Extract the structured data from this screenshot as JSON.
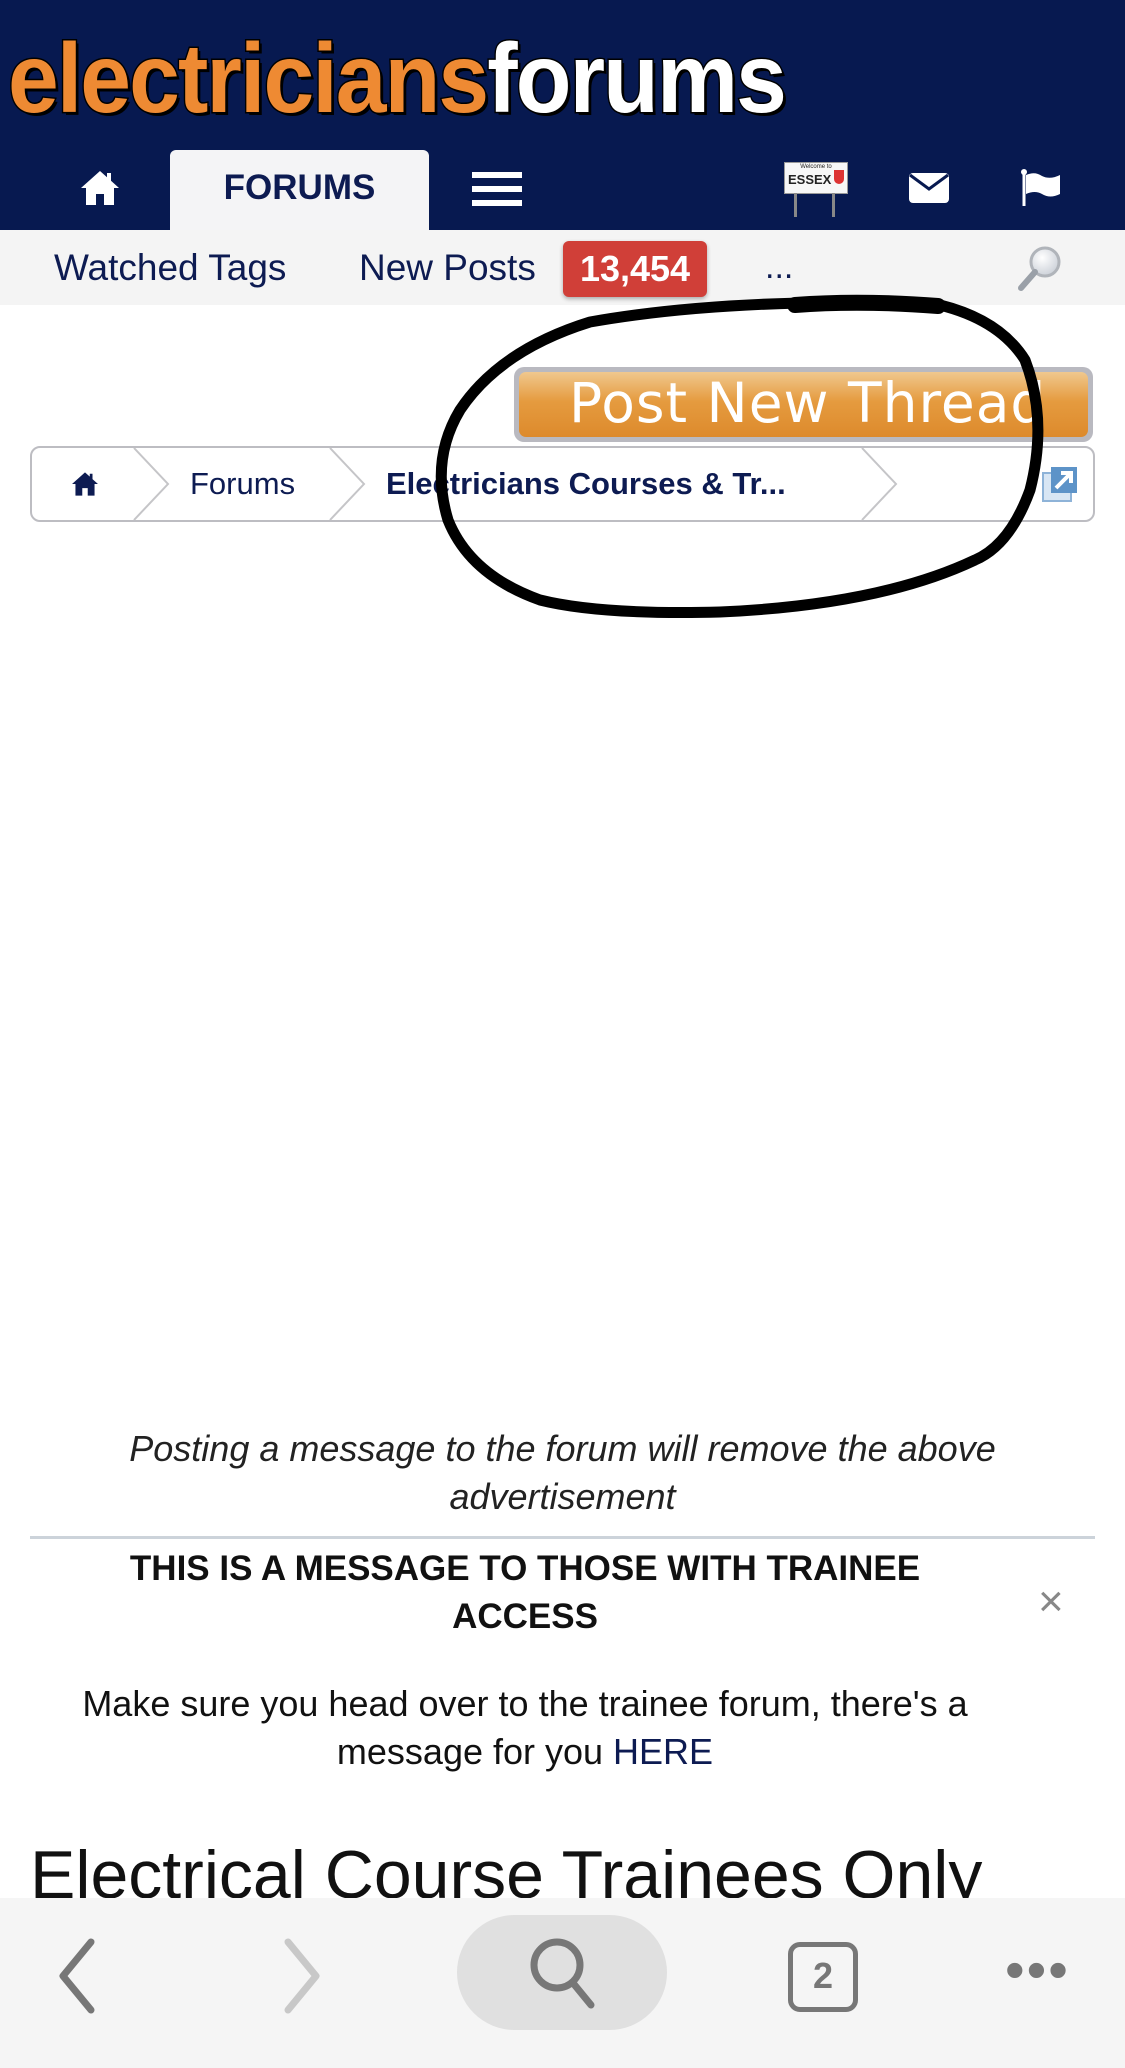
{
  "header": {
    "logo_part1": "electricians",
    "logo_part2": "forums",
    "colors": {
      "background": "#071950",
      "logo_orange": "#ee8a33",
      "logo_white": "#ffffff"
    },
    "nav": {
      "home_icon": "home-icon",
      "forums_tab": "FORUMS",
      "menu_icon": "hamburger-menu-icon",
      "essex_sign": {
        "small_text": "Welcome to",
        "text": "ESSEX"
      },
      "mail_icon": "envelope-icon",
      "flag_icon": "flag-icon"
    }
  },
  "subnav": {
    "watched_tags": "Watched Tags",
    "new_posts": "New Posts",
    "new_posts_count": "13,454",
    "more": "...",
    "search_icon": "magnifier-icon",
    "badge_color": "#d03f38"
  },
  "actions": {
    "post_new_thread": "Post New Thread"
  },
  "breadcrumb": {
    "home_icon": "home-icon",
    "items": [
      "Forums",
      "Electricians Courses & Tr..."
    ],
    "expand_icon": "external-link-icon"
  },
  "ad_notice": "Posting a message to the forum will remove the above advertisement",
  "message": {
    "title": "THIS IS A MESSAGE TO THOSE WITH TRAINEE ACCESS",
    "close": "×",
    "body_prefix": "Make sure you head over to the trainee forum, there's a message for you ",
    "link": "HERE"
  },
  "page_heading": "Electrical Course Trainees Only",
  "browser_toolbar": {
    "back_icon": "chevron-left-icon",
    "forward_icon": "chevron-right-icon",
    "search_icon": "search-icon",
    "tab_count": "2",
    "more_icon": "ellipsis-icon",
    "more": "•••"
  }
}
